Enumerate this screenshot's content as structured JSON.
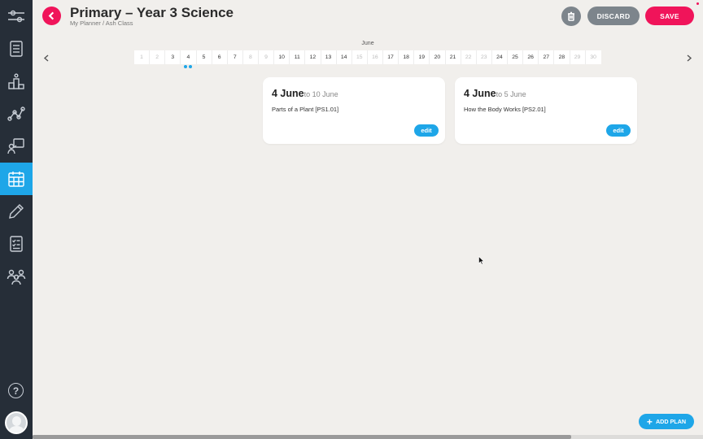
{
  "header": {
    "title": "Primary – Year 3 Science",
    "breadcrumb": "My Planner / Ash Class",
    "discard_label": "DISCARD",
    "save_label": "SAVE"
  },
  "sidebar": {
    "items": [
      {
        "icon": "sliders-icon"
      },
      {
        "icon": "checklist-icon"
      },
      {
        "icon": "podium-icon"
      },
      {
        "icon": "network-icon"
      },
      {
        "icon": "presentation-icon"
      },
      {
        "icon": "calendar-icon",
        "active": true
      },
      {
        "icon": "pencil-icon"
      },
      {
        "icon": "task-list-icon"
      },
      {
        "icon": "people-icon"
      }
    ],
    "help_label": "?"
  },
  "calendar": {
    "month": "June",
    "days": [
      "1",
      "2",
      "3",
      "4",
      "5",
      "6",
      "7",
      "8",
      "9",
      "10",
      "11",
      "12",
      "13",
      "14",
      "15",
      "16",
      "17",
      "18",
      "19",
      "20",
      "21",
      "22",
      "23",
      "24",
      "25",
      "26",
      "27",
      "28",
      "29",
      "30"
    ],
    "weekend_days": [
      "1",
      "2",
      "8",
      "9",
      "15",
      "16",
      "22",
      "23",
      "29",
      "30"
    ],
    "selected_day": "4"
  },
  "plans": [
    {
      "start": "4 June",
      "end": "to 10 June",
      "topic": "Parts of a Plant [PS1.01]",
      "edit_label": "edit"
    },
    {
      "start": "4 June",
      "end": "to 5 June",
      "topic": "How the Body Works [PS2.01]",
      "edit_label": "edit"
    }
  ],
  "footer": {
    "add_plan_label": "ADD PLAN"
  },
  "colors": {
    "sidebar": "#262e38",
    "accent_blue": "#1ea6e8",
    "accent_red": "#f0145a",
    "neutral_button": "#7d858c",
    "background": "#f1efec"
  }
}
